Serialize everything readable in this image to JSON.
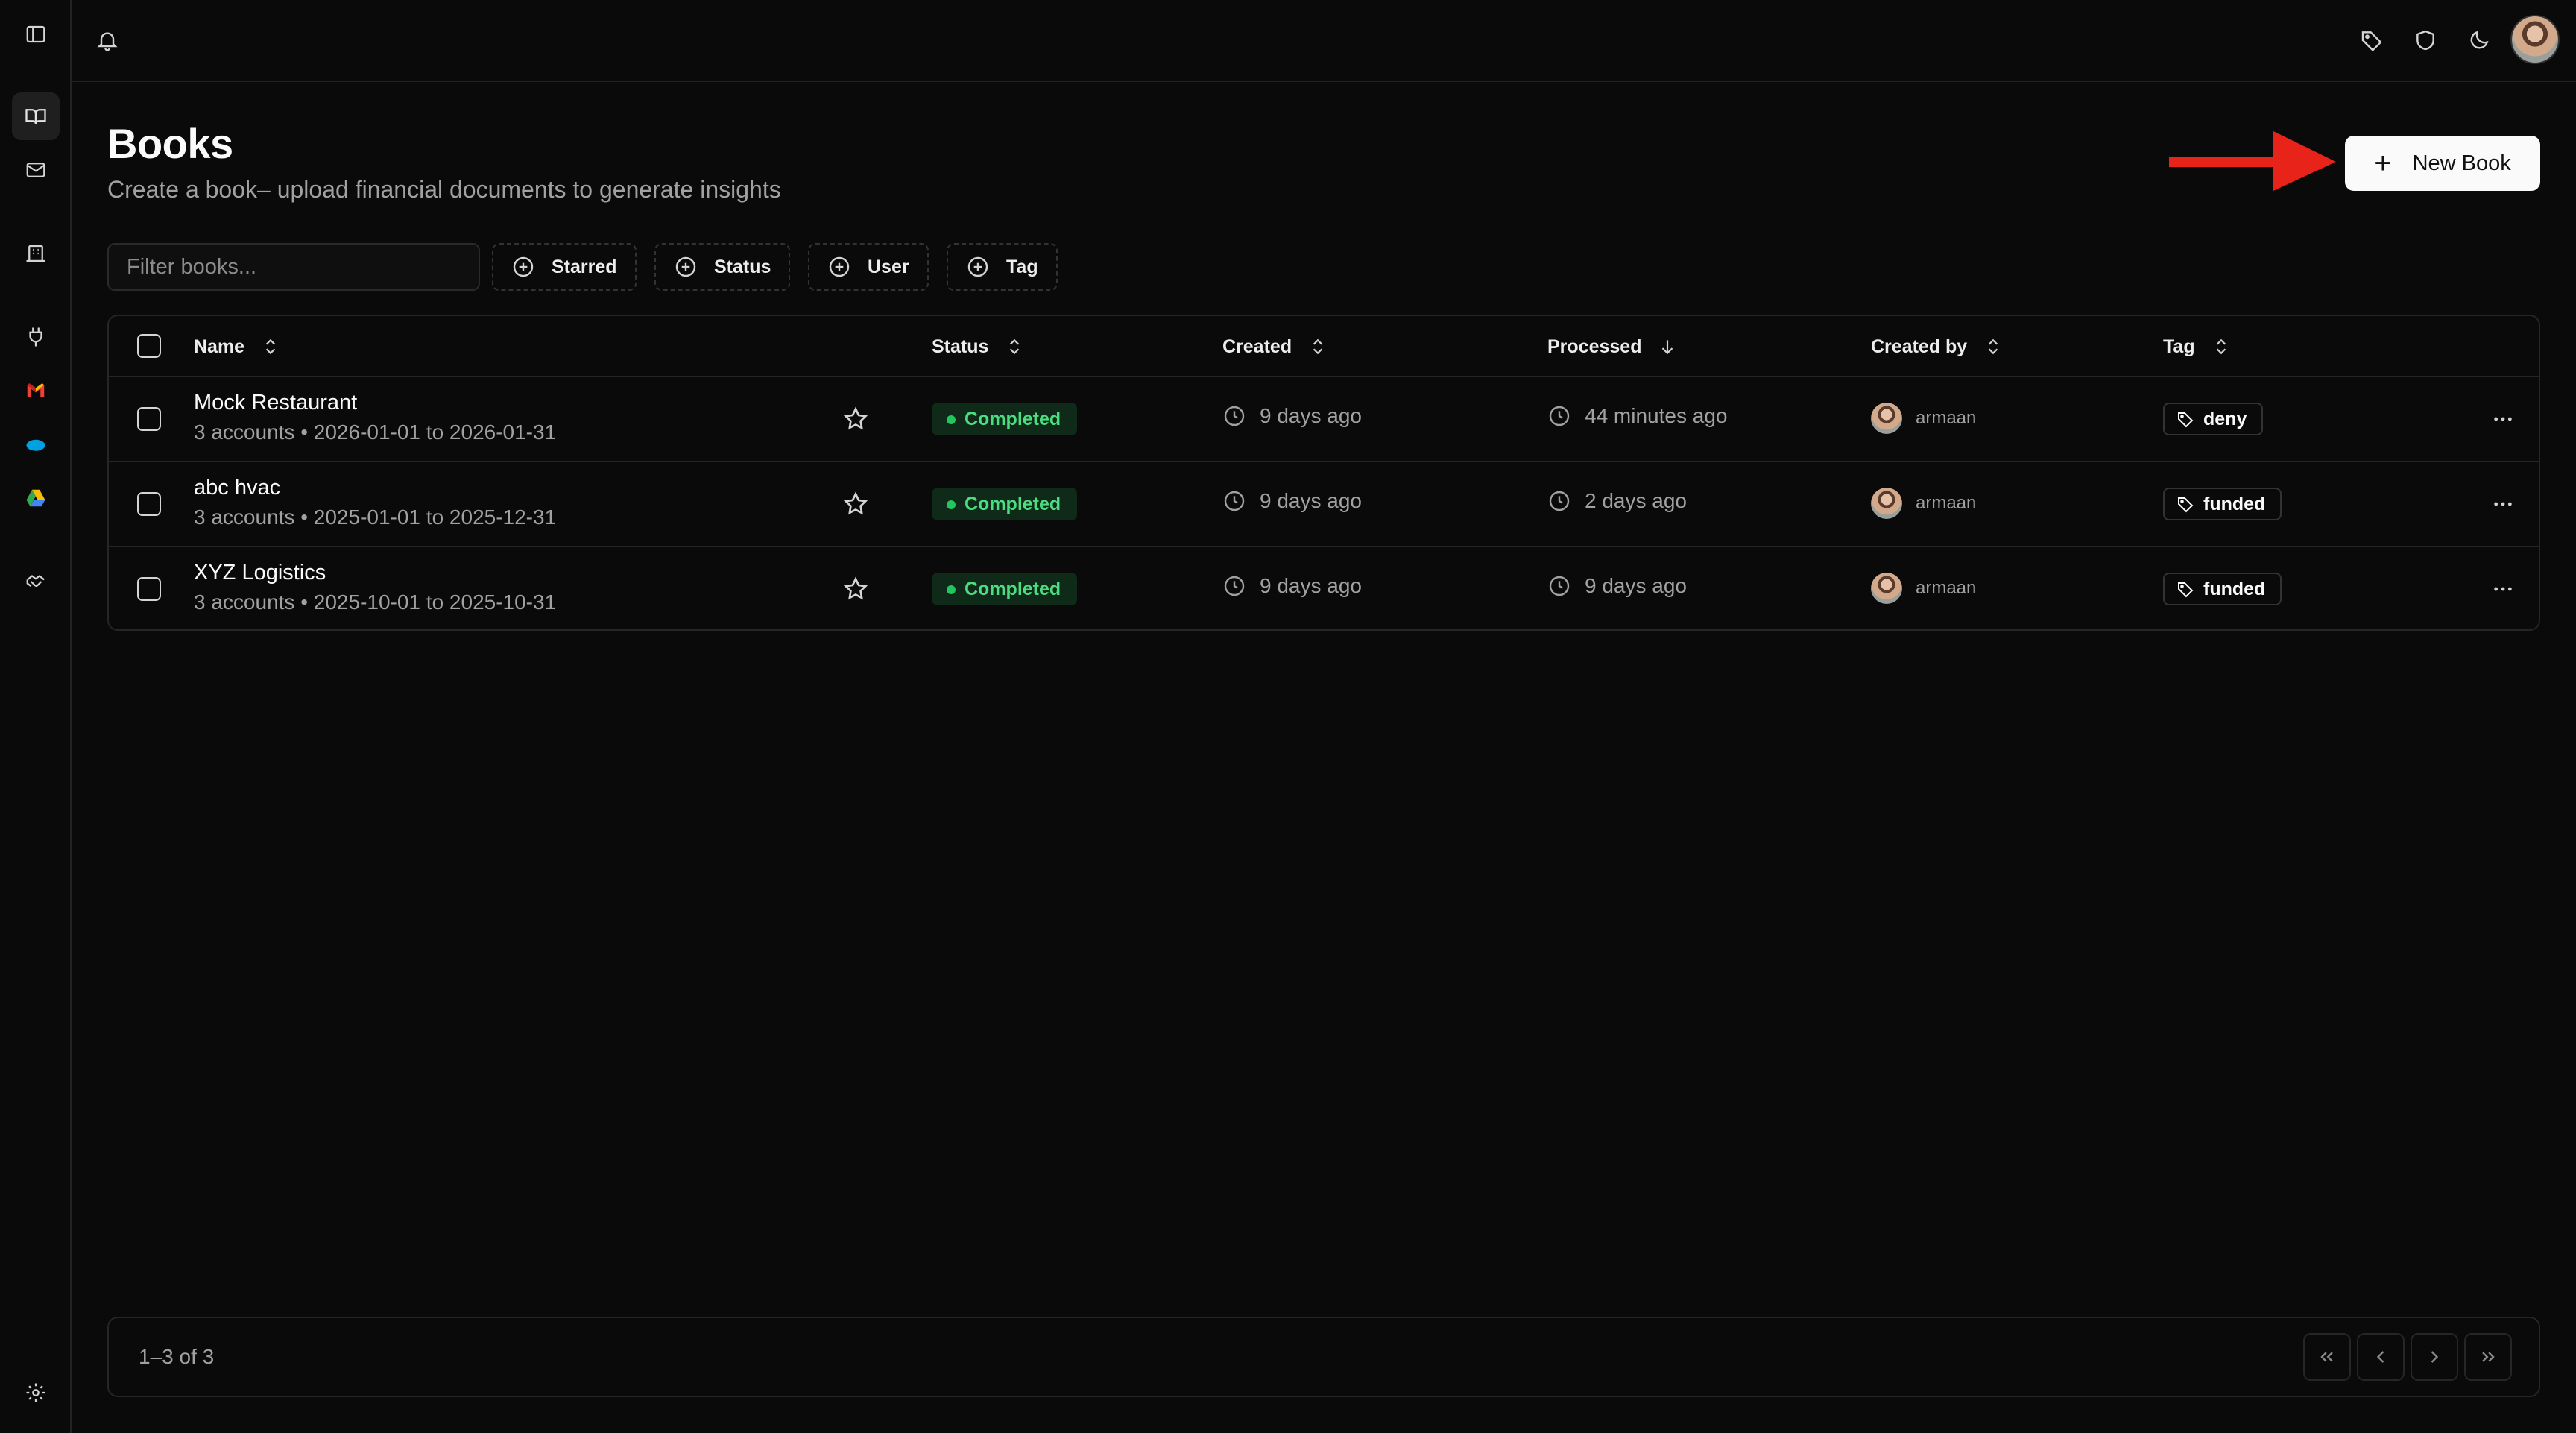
{
  "sidebar": {
    "icons": [
      "sidebar-toggle-icon",
      "book-open-icon",
      "mail-icon",
      "building-icon",
      "plug-icon",
      "gmail-icon",
      "salesforce-icon",
      "google-drive-icon",
      "handshake-icon",
      "settings-icon"
    ]
  },
  "topbar": {
    "icons": [
      "bell-icon",
      "tag-icon",
      "shield-icon",
      "moon-icon"
    ]
  },
  "header": {
    "title": "Books",
    "subtitle": "Create a book– upload financial documents to generate insights",
    "new_button_label": "New Book"
  },
  "filters": {
    "placeholder": "Filter books...",
    "chips": [
      "Starred",
      "Status",
      "User",
      "Tag"
    ]
  },
  "table": {
    "columns": [
      "Name",
      "Status",
      "Created",
      "Processed",
      "Created by",
      "Tag"
    ],
    "rows": [
      {
        "name": "Mock Restaurant",
        "details": "3 accounts • 2026-01-01 to 2026-01-31",
        "status": "Completed",
        "created": "9 days ago",
        "processed": "44 minutes ago",
        "created_by": "armaan",
        "tag": "deny"
      },
      {
        "name": "abc hvac",
        "details": "3 accounts • 2025-01-01 to 2025-12-31",
        "status": "Completed",
        "created": "9 days ago",
        "processed": "2 days ago",
        "created_by": "armaan",
        "tag": "funded"
      },
      {
        "name": "XYZ Logistics",
        "details": "3 accounts • 2025-10-01 to 2025-10-31",
        "status": "Completed",
        "created": "9 days ago",
        "processed": "9 days ago",
        "created_by": "armaan",
        "tag": "funded"
      }
    ]
  },
  "footer": {
    "count": "1–3 of 3"
  },
  "colors": {
    "background": "#0a0a0a",
    "accent_arrow": "#e8231a",
    "status_green": "#4ade80"
  }
}
